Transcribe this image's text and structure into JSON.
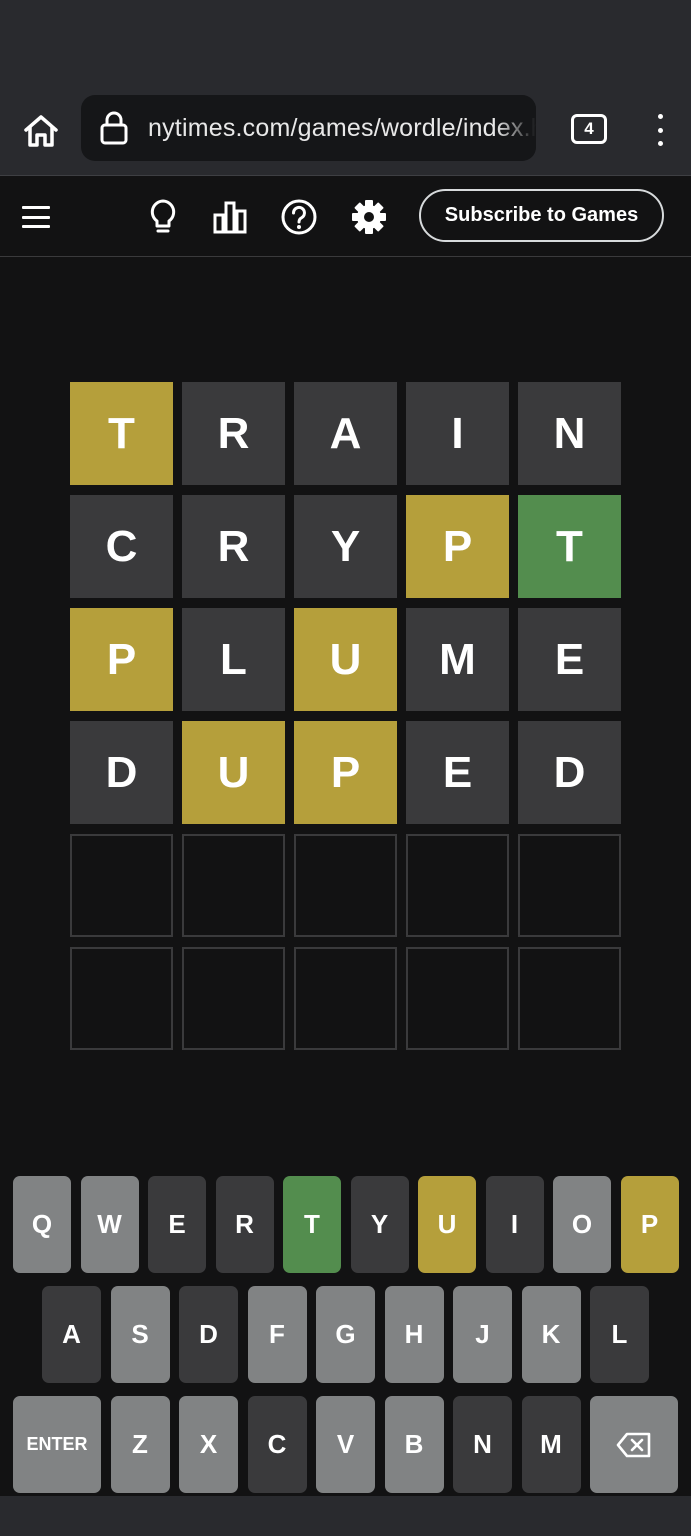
{
  "browser": {
    "url": "nytimes.com/games/wordle/index.html",
    "tab_count": "4"
  },
  "header": {
    "subscribe_label": "Subscribe to Games"
  },
  "board": {
    "rows": [
      [
        {
          "letter": "T",
          "state": "present"
        },
        {
          "letter": "R",
          "state": "absent"
        },
        {
          "letter": "A",
          "state": "absent"
        },
        {
          "letter": "I",
          "state": "absent"
        },
        {
          "letter": "N",
          "state": "absent"
        }
      ],
      [
        {
          "letter": "C",
          "state": "absent"
        },
        {
          "letter": "R",
          "state": "absent"
        },
        {
          "letter": "Y",
          "state": "absent"
        },
        {
          "letter": "P",
          "state": "present"
        },
        {
          "letter": "T",
          "state": "correct"
        }
      ],
      [
        {
          "letter": "P",
          "state": "present"
        },
        {
          "letter": "L",
          "state": "absent"
        },
        {
          "letter": "U",
          "state": "present"
        },
        {
          "letter": "M",
          "state": "absent"
        },
        {
          "letter": "E",
          "state": "absent"
        }
      ],
      [
        {
          "letter": "D",
          "state": "absent"
        },
        {
          "letter": "U",
          "state": "present"
        },
        {
          "letter": "P",
          "state": "present"
        },
        {
          "letter": "E",
          "state": "absent"
        },
        {
          "letter": "D",
          "state": "absent"
        }
      ],
      [
        {
          "letter": "",
          "state": "empty"
        },
        {
          "letter": "",
          "state": "empty"
        },
        {
          "letter": "",
          "state": "empty"
        },
        {
          "letter": "",
          "state": "empty"
        },
        {
          "letter": "",
          "state": "empty"
        }
      ],
      [
        {
          "letter": "",
          "state": "empty"
        },
        {
          "letter": "",
          "state": "empty"
        },
        {
          "letter": "",
          "state": "empty"
        },
        {
          "letter": "",
          "state": "empty"
        },
        {
          "letter": "",
          "state": "empty"
        }
      ]
    ]
  },
  "keyboard": {
    "rows": [
      [
        {
          "label": "Q",
          "state": "unused"
        },
        {
          "label": "W",
          "state": "unused"
        },
        {
          "label": "E",
          "state": "absent"
        },
        {
          "label": "R",
          "state": "absent"
        },
        {
          "label": "T",
          "state": "correct"
        },
        {
          "label": "Y",
          "state": "absent"
        },
        {
          "label": "U",
          "state": "present"
        },
        {
          "label": "I",
          "state": "absent"
        },
        {
          "label": "O",
          "state": "unused"
        },
        {
          "label": "P",
          "state": "present"
        }
      ],
      [
        {
          "label": "A",
          "state": "absent"
        },
        {
          "label": "S",
          "state": "unused"
        },
        {
          "label": "D",
          "state": "absent"
        },
        {
          "label": "F",
          "state": "unused"
        },
        {
          "label": "G",
          "state": "unused"
        },
        {
          "label": "H",
          "state": "unused"
        },
        {
          "label": "J",
          "state": "unused"
        },
        {
          "label": "K",
          "state": "unused"
        },
        {
          "label": "L",
          "state": "absent"
        }
      ],
      [
        {
          "label": "ENTER",
          "state": "unused"
        },
        {
          "label": "Z",
          "state": "unused"
        },
        {
          "label": "X",
          "state": "unused"
        },
        {
          "label": "C",
          "state": "absent"
        },
        {
          "label": "V",
          "state": "unused"
        },
        {
          "label": "B",
          "state": "unused"
        },
        {
          "label": "N",
          "state": "absent"
        },
        {
          "label": "M",
          "state": "absent"
        },
        {
          "label": "",
          "icon": "backspace-icon",
          "state": "unused"
        }
      ]
    ]
  },
  "colors": {
    "correct": "#538d4e",
    "present": "#b59f3b",
    "absent": "#3a3a3c",
    "unused_key": "#818384",
    "background": "#121213"
  }
}
